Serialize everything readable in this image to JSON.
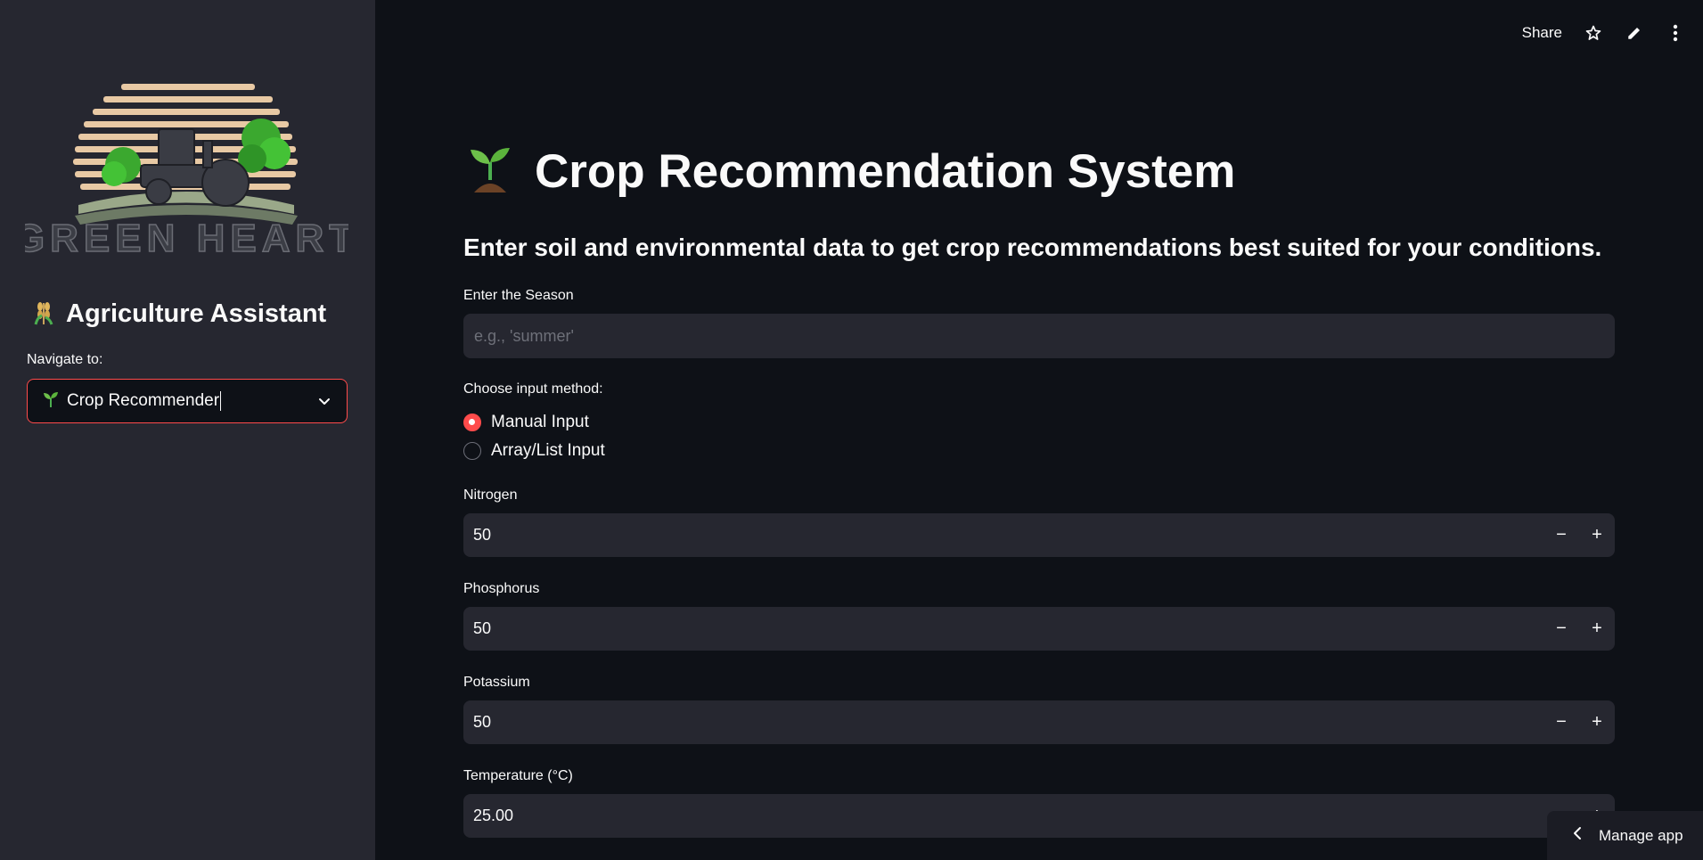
{
  "sidebar": {
    "logo_text": "GREEN HEART",
    "title_icon": "wheat-icon",
    "title": "Agriculture Assistant",
    "nav_label": "Navigate to:",
    "nav_selected_icon": "seedling-icon",
    "nav_selected": "Crop Recommender"
  },
  "header": {
    "share_label": "Share",
    "icons": [
      "star-icon",
      "pencil-icon",
      "kebab-menu-icon"
    ]
  },
  "main": {
    "title_icon": "seedling-icon",
    "title": "Crop Recommendation System",
    "subtitle": "Enter soil and environmental data to get crop recommendations best suited for your conditions.",
    "season": {
      "label": "Enter the Season",
      "placeholder": "e.g., 'summer'",
      "value": ""
    },
    "input_method": {
      "label": "Choose input method:",
      "options": [
        "Manual Input",
        "Array/List Input"
      ],
      "selected": "Manual Input"
    },
    "fields": [
      {
        "label": "Nitrogen",
        "value": "50"
      },
      {
        "label": "Phosphorus",
        "value": "50"
      },
      {
        "label": "Potassium",
        "value": "50"
      },
      {
        "label": "Temperature (°C)",
        "value": "25.00"
      }
    ],
    "stepper": {
      "minus": "−",
      "plus": "+"
    }
  },
  "manage_app": {
    "label": "Manage app"
  },
  "colors": {
    "background": "#0e1117",
    "sidebar": "#262730",
    "input_bg": "#262730",
    "accent": "#ff4b4b",
    "text": "#fafafa"
  }
}
